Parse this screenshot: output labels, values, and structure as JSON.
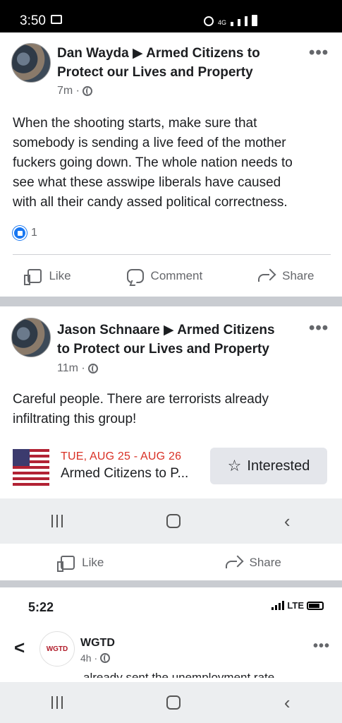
{
  "status_bar": {
    "time": "3:50",
    "network": "4G"
  },
  "post1": {
    "author": "Dan Wayda ▶ Armed Citizens to Protect our Lives and Property",
    "author_line1": "Dan Wayda ▶ Armed Citizens to",
    "author_line2": "Protect our Lives and Property",
    "time": "7m ·",
    "more": "•••",
    "text_lines": [
      "When the shooting starts, make sure that",
      "somebody is sending a live feed of the mother",
      "fuckers going down. The whole nation needs to",
      "see what these asswipe liberals have caused",
      "with all their candy assed political correctness."
    ],
    "reaction_count": "1",
    "actions": {
      "like": "Like",
      "comment": "Comment",
      "share": "Share"
    }
  },
  "post2": {
    "author_line1": "Jason Schnaare ▶ Armed Citizens",
    "author_line2": "to Protect our Lives and Property",
    "time": "11m ·",
    "more": "•••",
    "text_lines": [
      "Careful people. There are terrorists already",
      "infiltrating this group!"
    ],
    "event": {
      "date": "TUE, AUG 25 - AUG 26",
      "name": "Armed Citizens to P...",
      "button": "Interested"
    }
  },
  "nav_bar": {
    "recent": "|||",
    "home": "○",
    "back": "<"
  },
  "post3_actions": {
    "like": "Like",
    "share": "Share"
  },
  "screenshot2": {
    "time": "5:22",
    "network": "LTE",
    "page_name": "WGTD",
    "logo_text": "WGTD",
    "post_time": "4h ·",
    "more": "•••",
    "cut_text": "already sent the unemployment rate"
  },
  "colors": {
    "facebook_blue": "#1877f2",
    "event_red": "#d93025",
    "divider_gray": "#c9ccd1"
  }
}
